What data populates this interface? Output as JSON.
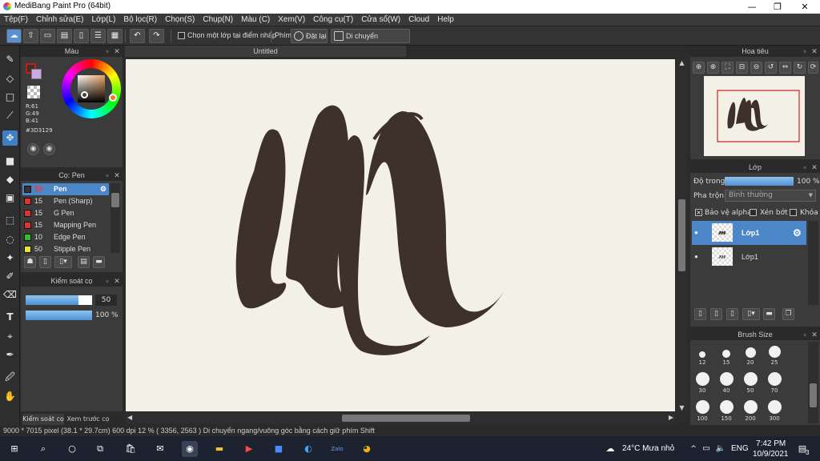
{
  "window": {
    "title": "MediBang Paint Pro (64bit)",
    "minimize": "—",
    "maximize": "❐",
    "close": "✕"
  },
  "menu": [
    "Tệp(F)",
    "Chỉnh sửa(E)",
    "Lớp(L)",
    "Bộ lọc(R)",
    "Chọn(S)",
    "Chụp(N)",
    "Màu (C)",
    "Xem(V)",
    "Công cụ(T)",
    "Cửa sổ(W)",
    "Cloud",
    "Help"
  ],
  "toolbar": {
    "select_layer_label": "Chọn một lớp tại điểm nhấp",
    "phim_label": "Phím",
    "reset_label": "Đặt lại",
    "move_label": "Di chuyển ngang/dọc"
  },
  "color_panel": {
    "title": "Màu",
    "r": "R:61",
    "g": "G:49",
    "b": "B:41",
    "hex": "#3D3129",
    "fg_color": "#3d3129"
  },
  "brush_panel": {
    "title": "Cọ: Pen",
    "items": [
      {
        "size": "50",
        "name": "Pen",
        "color": "#3d3129"
      },
      {
        "size": "15",
        "name": "Pen (Sharp)",
        "color": "#e03232"
      },
      {
        "size": "15",
        "name": "G Pen",
        "color": "#e03232"
      },
      {
        "size": "15",
        "name": "Mapping Pen",
        "color": "#e03232"
      },
      {
        "size": "10",
        "name": "Edge Pen",
        "color": "#30c030"
      },
      {
        "size": "50",
        "name": "Stipple Pen",
        "color": "#f0e030"
      }
    ]
  },
  "brush_control": {
    "title": "Kiểm soát cọ",
    "size_value": "50",
    "size_level": 0.8,
    "opacity_value": "100 %",
    "opacity_level": 1.0
  },
  "bottom_tabs": [
    "Kiểm soát cọ",
    "Xem trước cọ"
  ],
  "canvas": {
    "tab_title": "Untitled",
    "paper_color": "#f3f1e6",
    "ink_color": "#3d3129"
  },
  "navigator": {
    "title": "Hoa tiêu"
  },
  "layer_panel": {
    "title": "Lớp",
    "opacity_label": "Độ trong",
    "opacity_value": "100 %",
    "opacity_level": 1.0,
    "blend_label": "Pha trộn",
    "blend_value": "Bình thường",
    "protect_alpha": "Bảo vệ alpha",
    "clip": "Xén bớt",
    "lock": "Khóa",
    "layers": [
      "Lớp1",
      "Lớp1"
    ]
  },
  "brush_size_panel": {
    "title": "Brush Size",
    "sizes": [
      "12",
      "15",
      "20",
      "25",
      "30",
      "40",
      "50",
      "70",
      "100",
      "150",
      "200",
      "300"
    ]
  },
  "status": "9000 * 7015 pixel   (38.1 * 29.7cm)   600 dpi   12 %   ( 3356, 2563 )   Di chuyển ngang/vuông góc bằng cách giữ phím Shift",
  "taskbar": {
    "weather": "24°C  Mưa nhỏ",
    "lang": "ENG",
    "time": "7:42 PM",
    "date": "10/9/2021",
    "notif_count": "3"
  }
}
